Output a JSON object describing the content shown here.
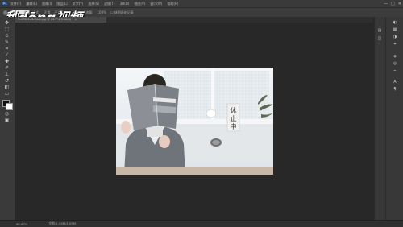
{
  "app": {
    "logo": "Ps",
    "menu": [
      "文件(F)",
      "编辑(E)",
      "图像(I)",
      "图层(L)",
      "文字(Y)",
      "选择(S)",
      "滤镜(T)",
      "3D(D)",
      "视图(V)",
      "窗口(W)",
      "帮助(H)"
    ],
    "window_controls": [
      "—",
      "□",
      "✕"
    ]
  },
  "options": {
    "items": [
      "模式:",
      "正常",
      "不透明度:",
      "100%",
      "流量:",
      "100%",
      "☐ 抹到历史记录"
    ]
  },
  "document": {
    "tab_title": "5c6f3b1d3e3b6.jpg @ 66.7%(RGB/8)",
    "tab_close": "×",
    "sign_chars": [
      "休",
      "止",
      "中"
    ]
  },
  "status": {
    "zoom": "66.67%",
    "doc_info": "文档:1.05M/1.05M"
  },
  "watermark": "秒dōng视频",
  "colors": {
    "foreground": "#111111",
    "background": "#ffffff"
  }
}
